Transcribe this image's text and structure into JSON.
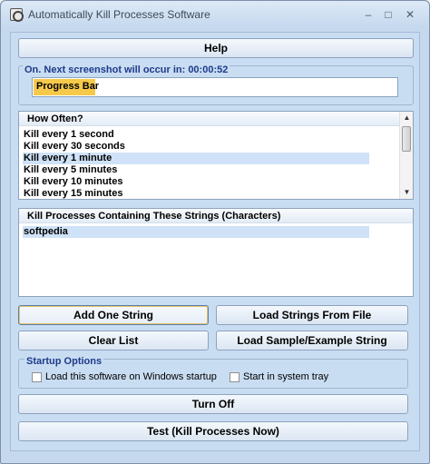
{
  "window": {
    "title": "Automatically Kill Processes Software",
    "controls": {
      "minimize": "–",
      "maximize": "□",
      "close": "✕"
    }
  },
  "help_button": "Help",
  "status": {
    "legend": "On. Next screenshot will occur in: 00:00:52",
    "progress_label": "Progress Bar",
    "progress_fraction": 0.17
  },
  "how_often": {
    "header": "How Often?",
    "items": [
      "Kill every 1 second",
      "Kill every 30 seconds",
      "Kill every 1 minute",
      "Kill every 5 minutes",
      "Kill every 10 minutes",
      "Kill every 15 minutes"
    ],
    "selected_index": 2
  },
  "strings_list": {
    "header": "Kill Processes Containing These Strings (Characters)",
    "items": [
      "softpedia"
    ]
  },
  "buttons": {
    "add_one_string": "Add One String",
    "load_strings_from_file": "Load Strings From File",
    "clear_list": "Clear List",
    "load_sample": "Load Sample/Example String",
    "turn_off": "Turn Off",
    "test": "Test (Kill Processes Now)"
  },
  "startup": {
    "legend": "Startup Options",
    "load_on_startup": {
      "label": "Load this software on Windows startup",
      "checked": false
    },
    "start_in_tray": {
      "label": "Start in system tray",
      "checked": false
    }
  },
  "colors": {
    "progress_fill": "#f6c94a",
    "legend_text": "#1e3a8a",
    "selection": "#cfe2f7"
  }
}
